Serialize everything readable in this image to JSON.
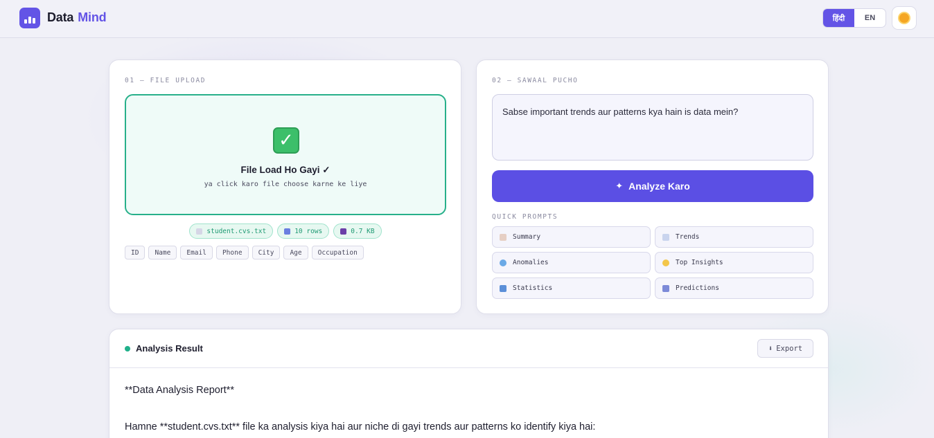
{
  "header": {
    "brand_first": "Data",
    "brand_second": "Mind",
    "lang_hindi": "हिंदी",
    "lang_en": "EN"
  },
  "upload": {
    "section_label": "01 — FILE UPLOAD",
    "dropzone_title": "File Load Ho Gayi ✓",
    "dropzone_subtitle": "ya click karo file choose karne ke liye",
    "file_name": "student.cvs.txt",
    "rows": "10 rows",
    "size": "0.7 KB",
    "columns": [
      "ID",
      "Name",
      "Email",
      "Phone",
      "City",
      "Age",
      "Occupation"
    ]
  },
  "ask": {
    "section_label": "02 — SAWAAL PUCHO",
    "question": "Sabse important trends aur patterns kya hain is data mein?",
    "analyze_label": "Analyze Karo",
    "quick_prompts_label": "QUICK PROMPTS",
    "prompts": [
      "Summary",
      "Trends",
      "Anomalies",
      "Top Insights",
      "Statistics",
      "Predictions"
    ]
  },
  "result": {
    "title": "Analysis Result",
    "export_label": "Export",
    "paragraphs": [
      "**Data Analysis Report**",
      "Hamne **student.cvs.txt** file ka analysis kiya hai aur niche di gayi trends aur patterns ko identify kiya hai:"
    ]
  },
  "colors": {
    "accent": "#5b4fe4",
    "success": "#27b08a"
  }
}
